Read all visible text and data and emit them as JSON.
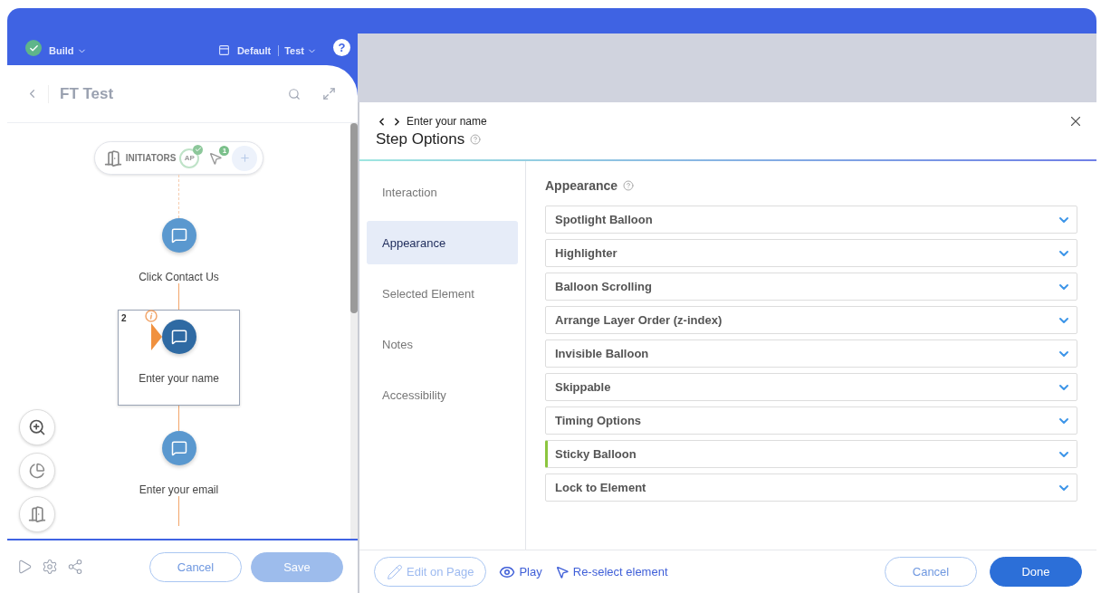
{
  "topbar": {
    "status": "Build",
    "environment": "Default",
    "mode": "Test",
    "help": "?"
  },
  "flow": {
    "title": "FT Test",
    "initiators": {
      "label": "INITIATORS",
      "badge": "AP",
      "count": "1"
    },
    "steps": [
      {
        "label": "Click Contact Us",
        "selected": false
      },
      {
        "label": "Enter your name",
        "selected": true,
        "number": "2"
      },
      {
        "label": "Enter your email",
        "selected": false
      }
    ],
    "buttons": [
      {
        "label": "Cancel",
        "kind": "outline"
      },
      {
        "label": "Save",
        "kind": "primary",
        "disabled": true
      }
    ]
  },
  "dialog": {
    "breadcrumb": "Enter your name",
    "title": "Step Options",
    "nav": [
      {
        "label": "Interaction",
        "selected": false
      },
      {
        "label": "Appearance",
        "selected": true
      },
      {
        "label": "Selected Element",
        "selected": false
      },
      {
        "label": "Notes",
        "selected": false
      },
      {
        "label": "Accessibility",
        "selected": false
      }
    ],
    "section_title": "Appearance",
    "options": [
      {
        "label": "Spotlight Balloon",
        "configured": false
      },
      {
        "label": "Highlighter",
        "configured": false
      },
      {
        "label": "Balloon Scrolling",
        "configured": false
      },
      {
        "label": "Arrange Layer Order (z-index)",
        "configured": false
      },
      {
        "label": "Invisible Balloon",
        "configured": false
      },
      {
        "label": "Skippable",
        "configured": false
      },
      {
        "label": "Timing Options",
        "configured": false
      },
      {
        "label": "Sticky Balloon",
        "configured": true
      },
      {
        "label": "Lock to Element",
        "configured": false
      }
    ],
    "actions": [
      {
        "label": "Edit on Page",
        "kind": "edit"
      },
      {
        "label": "Play",
        "kind": "play"
      },
      {
        "label": "Re-select element",
        "kind": "reselect"
      }
    ],
    "buttons": [
      {
        "label": "Cancel",
        "kind": "outline"
      },
      {
        "label": "Done",
        "kind": "primary",
        "disabled": false
      }
    ]
  }
}
